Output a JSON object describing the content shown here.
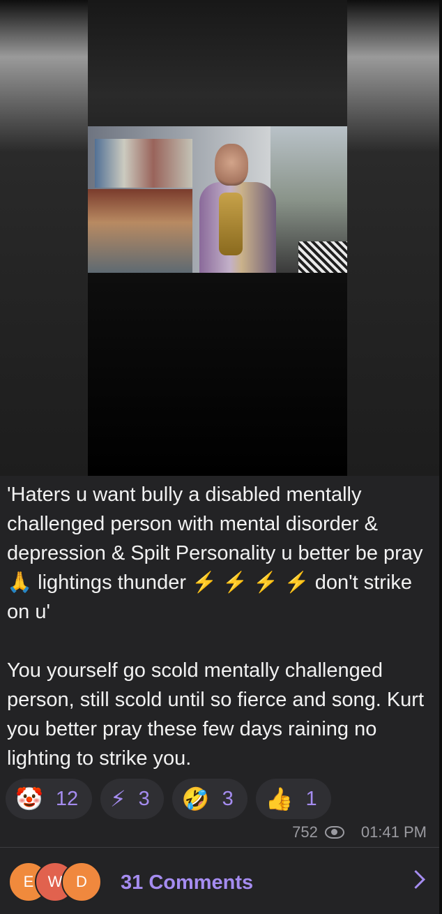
{
  "message": {
    "paragraph1": "'Haters u want bully a disabled mentally challenged person with mental disorder & depression & Spilt Personality u better be pray 🙏 lightings thunder ⚡️ ⚡️ ⚡️ ⚡️ don't strike on u'",
    "paragraph2": "You yourself go scold mentally challenged person, still scold until so fierce and song. Kurt you better pray these few days raining no lighting to strike you."
  },
  "reactions": [
    {
      "emoji": "🤡",
      "icon": "clown-emoji",
      "count": "12"
    },
    {
      "emoji": "⚡",
      "icon": "lightning-emoji",
      "count": "3"
    },
    {
      "emoji": "🤣",
      "icon": "rofl-emoji",
      "count": "3"
    },
    {
      "emoji": "👍",
      "icon": "thumbs-up-emoji",
      "count": "1"
    }
  ],
  "meta": {
    "views": "752",
    "time": "01:41 PM"
  },
  "comments": {
    "avatars": [
      "E",
      "W",
      "D"
    ],
    "label": "31 Comments"
  },
  "colors": {
    "accent": "#a58cf0",
    "bubble": "#232325",
    "text": "#f2f2f2",
    "meta": "#9b9ba1"
  }
}
